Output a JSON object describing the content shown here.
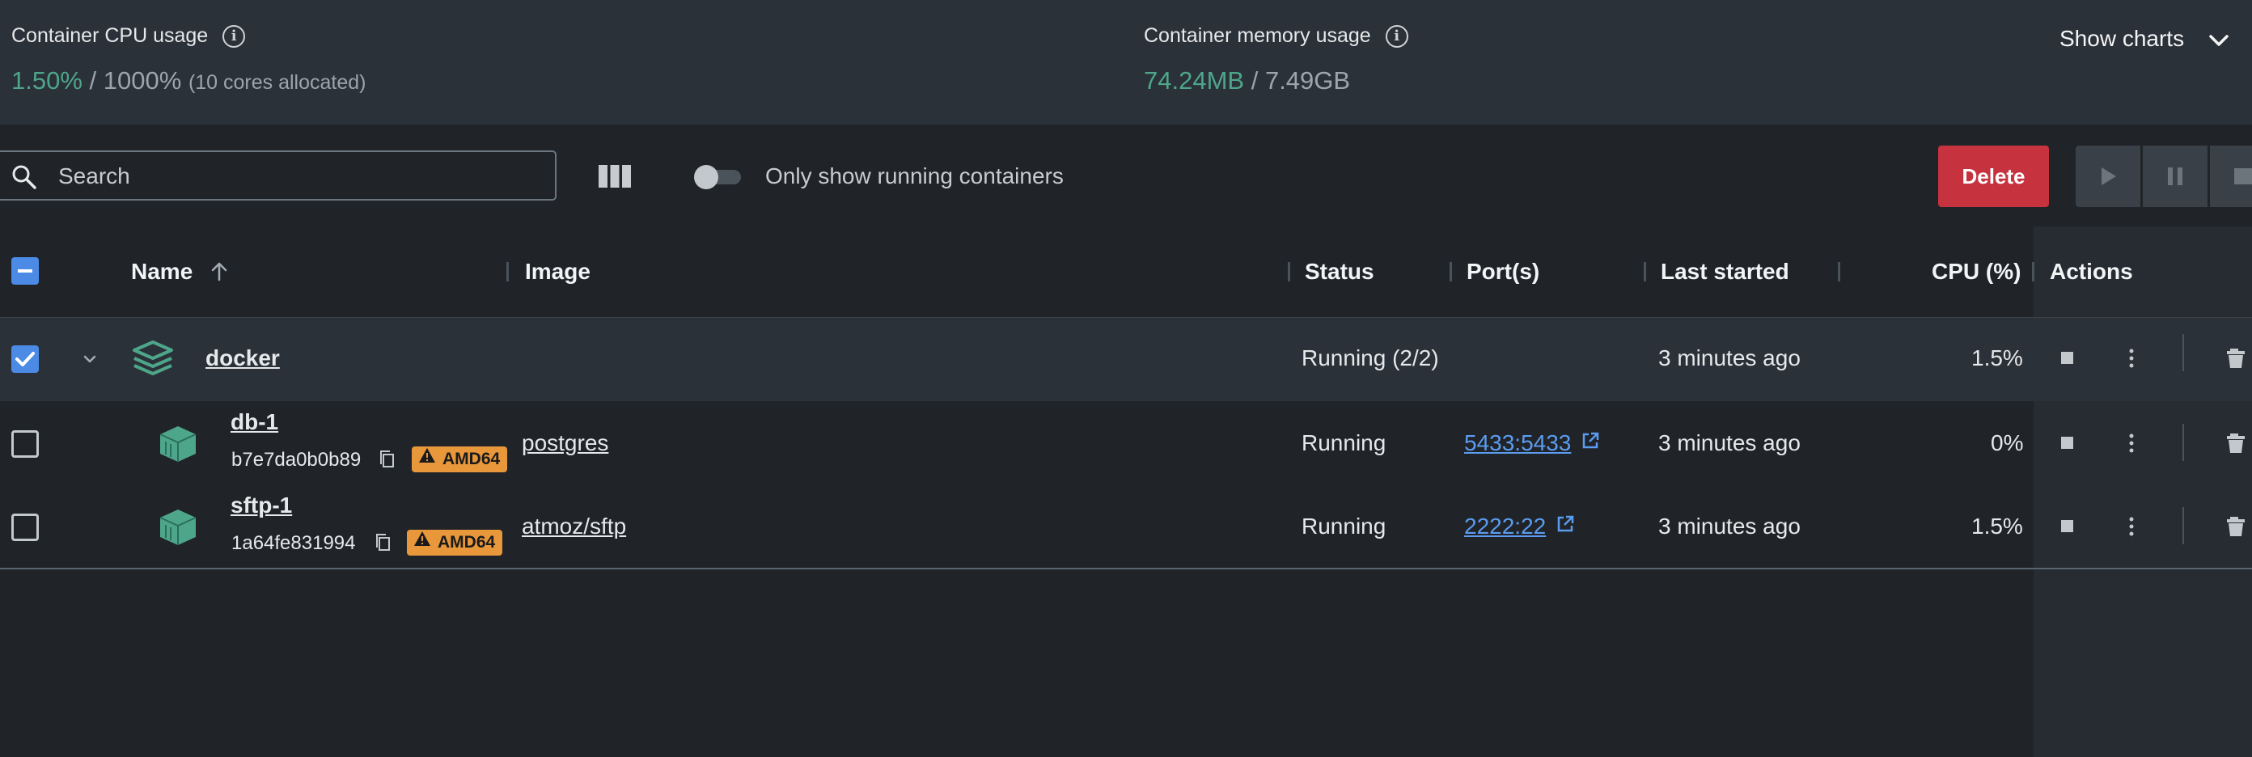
{
  "stats": {
    "cpu": {
      "label": "Container CPU usage",
      "used": "1.50%",
      "sep": "/",
      "total": "1000%",
      "note": "(10 cores allocated)"
    },
    "memory": {
      "label": "Container memory usage",
      "used": "74.24MB",
      "sep": "/",
      "total": "7.49GB"
    },
    "show_charts_label": "Show charts"
  },
  "toolbar": {
    "search_placeholder": "Search",
    "running_only_label": "Only show running containers",
    "running_only_checked": false,
    "delete_label": "Delete"
  },
  "table": {
    "columns": {
      "name": "Name",
      "image": "Image",
      "status": "Status",
      "ports": "Port(s)",
      "last_started": "Last started",
      "cpu": "CPU (%)",
      "actions": "Actions"
    },
    "sort": {
      "column": "Name",
      "direction": "ascending"
    },
    "group": {
      "name": "docker",
      "status": "Running (2/2)",
      "last_started": "3 minutes ago",
      "cpu": "1.5%",
      "selected": true,
      "expanded": true
    },
    "rows": [
      {
        "name": "db-1",
        "id": "b7e7da0b0b89",
        "arch": "AMD64",
        "image": "postgres",
        "status": "Running",
        "ports": "5433:5433",
        "last_started": "3 minutes ago",
        "cpu": "0%",
        "selected": false
      },
      {
        "name": "sftp-1",
        "id": "1a64fe831994",
        "arch": "AMD64",
        "image": "atmoz/sftp",
        "status": "Running",
        "ports": "2222:22",
        "last_started": "3 minutes ago",
        "cpu": "1.5%",
        "selected": false
      }
    ]
  },
  "colors": {
    "accent": "#4b8be6",
    "success": "#4ea68a",
    "danger": "#c7323f",
    "warning": "#e8973b"
  }
}
